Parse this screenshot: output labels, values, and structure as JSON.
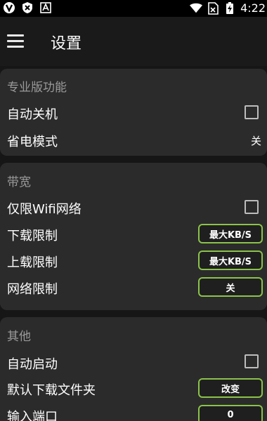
{
  "status_bar": {
    "time": "4:22",
    "left_icons": [
      "app-icon",
      "shield-icon",
      "text-icon"
    ],
    "right_icons": [
      "wifi-icon",
      "no-sim-icon",
      "battery-icon"
    ]
  },
  "app_bar": {
    "title": "设置",
    "menu_icon": "hamburger-menu-icon"
  },
  "sections": [
    {
      "title": "专业版功能",
      "rows": [
        {
          "label": "自动关机",
          "control": "checkbox",
          "checked": false
        },
        {
          "label": "省电模式",
          "control": "text",
          "value": "关"
        }
      ]
    },
    {
      "title": "带宽",
      "rows": [
        {
          "label": "仅限Wifi网络",
          "control": "checkbox",
          "checked": false
        },
        {
          "label": "下载限制",
          "control": "button",
          "value": "最大KB/S"
        },
        {
          "label": "上载限制",
          "control": "button",
          "value": "最大KB/S"
        },
        {
          "label": "网络限制",
          "control": "button",
          "value": "关"
        }
      ]
    },
    {
      "title": "其他",
      "rows": [
        {
          "label": "自动启动",
          "control": "checkbox",
          "checked": false
        },
        {
          "label": "默认下载文件夹",
          "control": "button",
          "value": "改变"
        },
        {
          "label": "输入端口",
          "control": "button",
          "value": "0"
        }
      ]
    }
  ],
  "colors": {
    "background": "#161616",
    "card": "#2b2b2b",
    "accent_border": "#8bc34a",
    "section_title": "#9a9a9a"
  }
}
